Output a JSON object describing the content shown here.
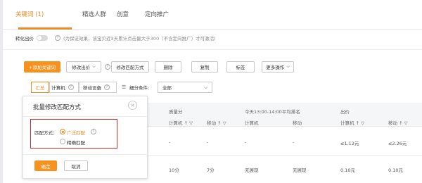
{
  "tabs": [
    {
      "label": "关键词 (1)",
      "active": true
    },
    {
      "label": "精选人群",
      "active": false
    },
    {
      "label": "创意",
      "active": false
    },
    {
      "label": "定向推广",
      "active": false
    }
  ],
  "conversion": {
    "label": "转化出价",
    "note": "(为保证效果，该宝贝近3天累计点击量大于300（不含定向推广）才可激活)"
  },
  "toolbar": {
    "add_keyword": "+添加关键词",
    "modify_bid": "修改出价",
    "modify_match": "修改匹配方式",
    "delete": "删除",
    "copy": "复制",
    "tag": "标签",
    "more": "更多操作"
  },
  "filters": {
    "summary": "汇总",
    "computer": "计算机",
    "mobile": "移动设备",
    "segment_label": "细分条件:",
    "segment_value": "全部"
  },
  "table": {
    "group_quality": "质量分",
    "group_rank": "今天13:00-14:00平均排名",
    "group_bid": "出价",
    "sub_computer": "计算机",
    "sub_mobile": "移动",
    "sort_arrows": "↑ ▽",
    "rows": [
      {
        "q_pc": "-",
        "q_mobile": "-",
        "rank_pc": "-",
        "rank_mobile": "-",
        "bid_pc": "≤1.12元",
        "bid_mobile": "≤2.26元"
      },
      {
        "q_pc": "10分",
        "q_mobile": "7分",
        "rank_pc": "无展现",
        "rank_mobile": "无展现",
        "bid_pc": "0.10元",
        "bid_mobile": "0.10元"
      }
    ]
  },
  "modal": {
    "title": "批量修改匹配方式",
    "match_label": "匹配方式：",
    "options": [
      {
        "label": "广泛匹配",
        "checked": true
      },
      {
        "label": "精确匹配",
        "checked": false
      }
    ],
    "confirm": "确定",
    "cancel": "取消"
  },
  "colors": {
    "accent": "#f08a24",
    "highlight": "#d42a2a"
  }
}
